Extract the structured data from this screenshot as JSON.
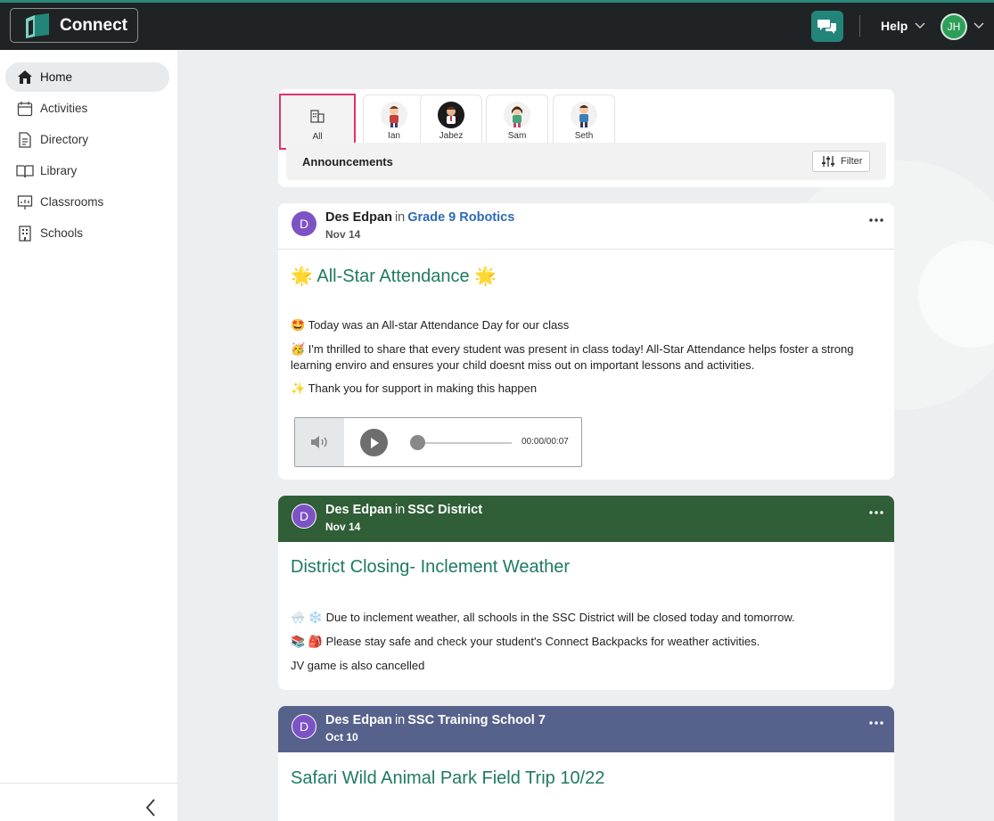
{
  "app": {
    "name": "Connect"
  },
  "topbar": {
    "help_label": "Help",
    "user_initials": "JH"
  },
  "sidebar": {
    "items": [
      {
        "label": "Home",
        "icon": "home-icon"
      },
      {
        "label": "Activities",
        "icon": "calendar-icon"
      },
      {
        "label": "Directory",
        "icon": "document-icon"
      },
      {
        "label": "Library",
        "icon": "book-icon"
      },
      {
        "label": "Classrooms",
        "icon": "presentation-icon"
      },
      {
        "label": "Schools",
        "icon": "building-icon"
      }
    ]
  },
  "students": [
    {
      "name": "All"
    },
    {
      "name": "Ian"
    },
    {
      "name": "Jabez"
    },
    {
      "name": "Sam"
    },
    {
      "name": "Seth"
    }
  ],
  "feed": {
    "section_label": "Announcements",
    "filter_label": "Filter"
  },
  "posts": [
    {
      "avatar": "D",
      "author": "Des Edpan",
      "in": "in",
      "group": "Grade 9 Robotics",
      "date": "Nov 14",
      "title": "🌟 All-Star Attendance 🌟",
      "lines": [
        "🤩 Today was an All-star Attendance Day for our class",
        "🥳 I'm thrilled to share that every student was present in class today! All-Star Attendance helps foster a strong learning enviro and ensures your child doesnt miss out on important lessons and activities.",
        "✨ Thank you for support in making this happen"
      ],
      "audio_time": "00:00/00:07"
    },
    {
      "avatar": "D",
      "author": "Des Edpan",
      "in": "in",
      "group": "SSC District",
      "date": "Nov 14",
      "header_color": "#2f5e37",
      "title": "District Closing- Inclement Weather",
      "lines": [
        "🌨️ ❄️ Due to inclement weather, all schools in the SSC District will be closed today and tomorrow.",
        "📚 🎒 Please stay safe and check your student's Connect Backpacks for weather activities.",
        "JV game is also cancelled"
      ]
    },
    {
      "avatar": "D",
      "author": "Des Edpan",
      "in": "in",
      "group": "SSC Training School 7",
      "date": "Oct 10",
      "header_color": "#56628b",
      "title": "Safari Wild Animal Park Field Trip 10/22"
    }
  ]
}
